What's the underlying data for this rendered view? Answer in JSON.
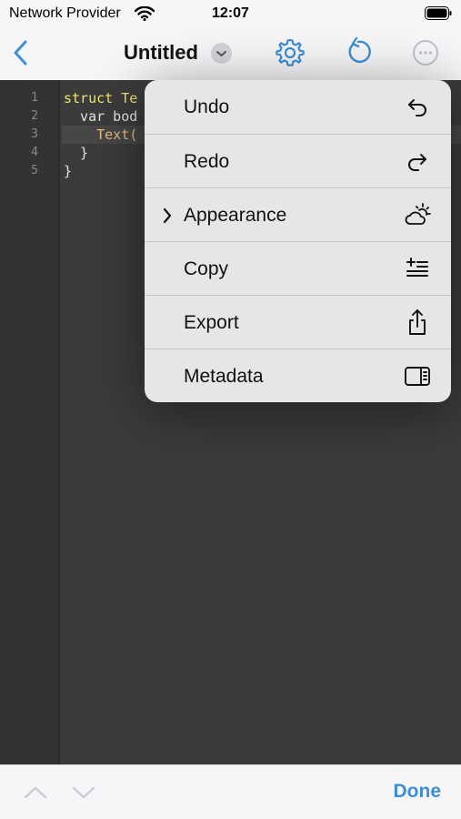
{
  "status_bar": {
    "carrier": "Network Provider",
    "time": "12:07"
  },
  "nav_bar": {
    "back_icon": "chevron-left-icon",
    "title": "Untitled",
    "title_menu_icon": "chevron-down-circle-icon",
    "settings_icon": "gear-icon",
    "undo_icon": "undo-icon",
    "more_icon": "ellipsis-circle-icon"
  },
  "editor": {
    "line_numbers": [
      "1",
      "2",
      "3",
      "4",
      "5"
    ],
    "lines": [
      {
        "text": "struct Te"
      },
      {
        "text": "  var bod"
      },
      {
        "text": "    Text("
      },
      {
        "text": "  }"
      },
      {
        "text": "}"
      }
    ],
    "colors": {
      "keyword": "#f3e36c",
      "type": "#e8b985",
      "plain": "#e3e3e3",
      "background": "#3b3b3b"
    }
  },
  "menu": {
    "items": [
      {
        "label": "Undo",
        "icon": "arrow-uturn-left-icon"
      },
      {
        "label": "Redo",
        "icon": "arrow-uturn-right-icon"
      },
      {
        "label": "Appearance",
        "icon": "cloud-sun-icon",
        "has_submenu": true
      },
      {
        "label": "Copy",
        "icon": "text-badge-plus-icon"
      },
      {
        "label": "Export",
        "icon": "share-icon"
      },
      {
        "label": "Metadata",
        "icon": "sidebar-right-icon"
      }
    ]
  },
  "toolbar": {
    "prev_icon": "chevron-up-icon",
    "next_icon": "chevron-down-icon",
    "done_label": "Done"
  },
  "colors": {
    "accent": "#3b8fd6",
    "disabled": "#b9c3cf"
  }
}
